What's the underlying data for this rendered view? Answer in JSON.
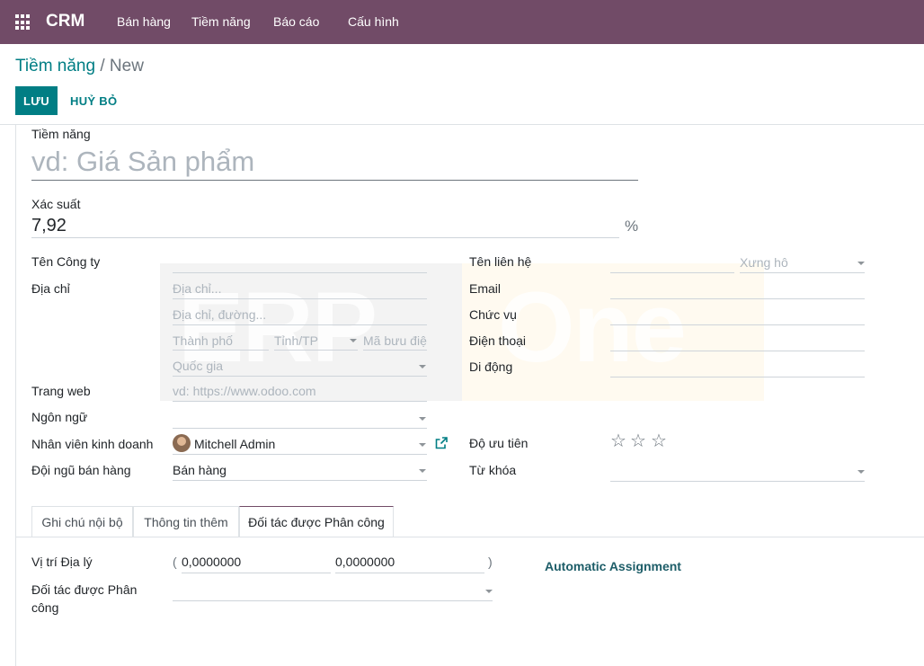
{
  "navbar": {
    "brand": "CRM",
    "menu": [
      "Bán hàng",
      "Tiềm năng",
      "Báo cáo",
      "Cấu hình"
    ]
  },
  "breadcrumb": {
    "parent": "Tiềm năng",
    "separator": "/",
    "current": "New"
  },
  "buttons": {
    "save": "LƯU",
    "discard": "HUỶ BỎ"
  },
  "form": {
    "name_label": "Tiềm năng",
    "name_placeholder": "vd: Giá Sản phẩm",
    "probability_label": "Xác suất",
    "probability_value": "7,92",
    "probability_unit": "%",
    "left": {
      "company_label": "Tên Công ty",
      "address_label": "Địa chỉ",
      "street_placeholder": "Địa chỉ...",
      "street2_placeholder": "Địa chỉ, đường...",
      "city_placeholder": "Thành phố",
      "state_placeholder": "Tỉnh/TP",
      "zip_placeholder": "Mã bưu điệ",
      "country_placeholder": "Quốc gia",
      "website_label": "Trang web",
      "website_placeholder": "vd: https://www.odoo.com",
      "language_label": "Ngôn ngữ",
      "salesperson_label": "Nhân viên kinh doanh",
      "salesperson_value": "Mitchell Admin",
      "team_label": "Đội ngũ bán hàng",
      "team_value": "Bán hàng"
    },
    "right": {
      "contact_label": "Tên liên hệ",
      "title_placeholder": "Xưng hô",
      "email_label": "Email",
      "job_label": "Chức vụ",
      "phone_label": "Điện thoại",
      "mobile_label": "Di động",
      "priority_label": "Độ ưu tiên",
      "priority_stars": 0,
      "priority_max": 3,
      "tags_label": "Từ khóa"
    }
  },
  "watermark": {
    "left": "ERP",
    "right": "One"
  },
  "tabs": [
    "Ghi chú nội bộ",
    "Thông tin thêm",
    "Đối tác được Phân công"
  ],
  "active_tab": 2,
  "assigned": {
    "geo_label": "Vị trí Địa lý",
    "open_paren": "(",
    "latitude": "0,0000000",
    "longitude": "0,0000000",
    "close_paren": ")",
    "auto_assign": "Automatic Assignment",
    "partner_label_line1": "Đối tác được Phân",
    "partner_label_line2": "công"
  },
  "colors": {
    "brand": "#714b67",
    "primary": "#017e84"
  },
  "icons": {
    "apps": "apps-grid-icon",
    "external": "external-link-icon",
    "star": "star-outline-icon",
    "dropdown": "chevron-down-icon"
  }
}
